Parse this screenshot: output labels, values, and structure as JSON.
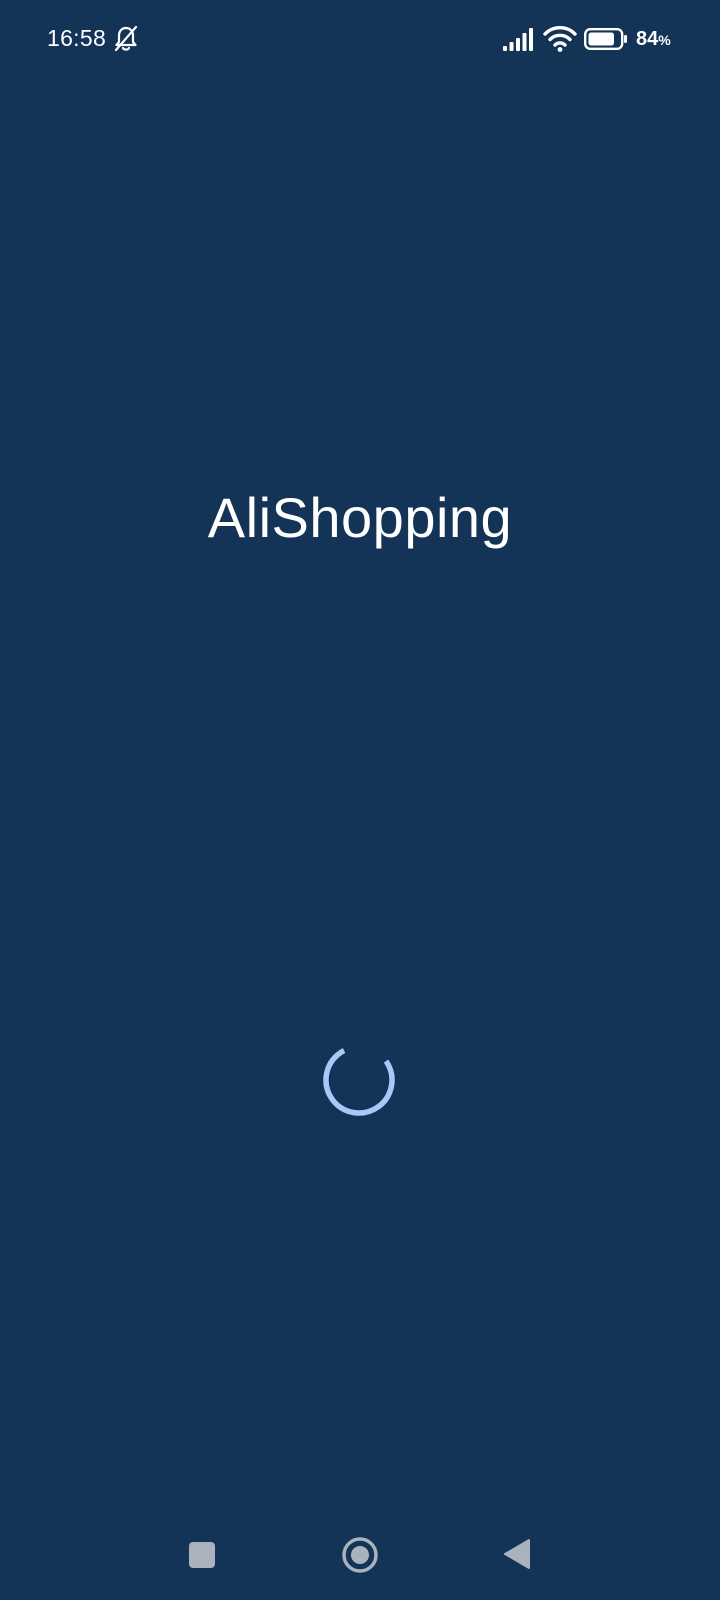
{
  "status_bar": {
    "time": "16:58",
    "battery_percent": "84",
    "battery_unit": "%",
    "battery_level": 0.84,
    "icons": [
      "bell-muted-icon",
      "signal-icon",
      "wifi-icon",
      "battery-icon"
    ]
  },
  "splash": {
    "title": "AliShopping",
    "loading": true
  },
  "nav_bar": {
    "buttons": [
      "recents",
      "home",
      "back"
    ]
  },
  "colors": {
    "background": "#133357",
    "text": "#ffffff",
    "spinner": "#a9c7f7",
    "nav_icons": "#a9b2bd"
  }
}
